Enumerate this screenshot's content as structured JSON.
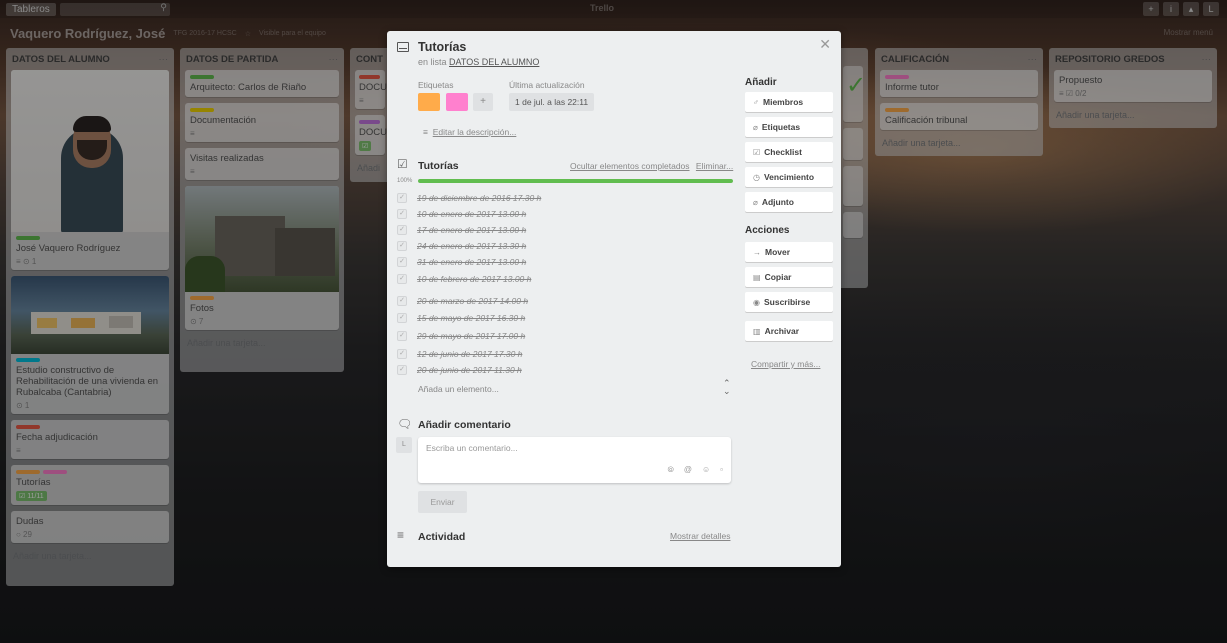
{
  "topbar": {
    "boards_label": "Tableros",
    "logo": "Trello",
    "right_icons": [
      "+",
      "i",
      "▴",
      "L"
    ]
  },
  "board": {
    "title": "Vaquero Rodríguez, José",
    "tag": "TFG 2016-17 HCSC",
    "visibility": "Visible para el equipo",
    "menu": "Mostrar menú"
  },
  "lists": [
    {
      "title": "DATOS DEL ALUMNO",
      "cards": [
        {
          "title": "José Vaquero Rodríguez",
          "badges": "≡  ⊙ 1"
        },
        {
          "title": "Estudio constructivo de Rehabilitación de una vivienda en Rubalcaba (Cantabria)",
          "badges": "⊙ 1"
        },
        {
          "title": "Fecha adjudicación",
          "badges": "≡"
        },
        {
          "title": "Tutorías",
          "badges": "☑ 11/11"
        },
        {
          "title": "Dudas",
          "badges": "○ 29"
        }
      ],
      "add": "Añadir una tarjeta..."
    },
    {
      "title": "DATOS DE PARTIDA",
      "cards": [
        {
          "title": "Arquitecto: Carlos de Riaño",
          "badges": ""
        },
        {
          "title": "Documentación",
          "badges": "≡"
        },
        {
          "title": "Visitas realizadas",
          "badges": "≡"
        },
        {
          "title": "Fotos",
          "badges": "⊙ 7"
        }
      ],
      "add": "Añadir una tarjeta..."
    },
    {
      "title": "CONT",
      "cards": [
        {
          "title": "DOCU",
          "badges": "≡"
        },
        {
          "title": "DOCU",
          "badges": ""
        }
      ],
      "add": "Añadi"
    },
    {
      "title": "CALIFICACIÓN",
      "cards": [
        {
          "title": "Informe tutor",
          "badges": ""
        },
        {
          "title": "Calificación tribunal",
          "badges": ""
        }
      ],
      "add": "Añadir una tarjeta..."
    },
    {
      "title": "REPOSITORIO GREDOS",
      "cards": [
        {
          "title": "Propuesto",
          "badges": "≡  ☑ 0/2"
        }
      ],
      "add": "Añadir una tarjeta..."
    }
  ],
  "modal": {
    "title": "Tutorías",
    "in_list_prefix": "en lista",
    "in_list_name": "DATOS DEL ALUMNO",
    "labels_heading": "Etiquetas",
    "updated_heading": "Última actualización",
    "updated_value": "1 de jul. a las 22:11",
    "label_colors": [
      "#ffab4a",
      "#ff80ce"
    ],
    "edit_description": "Editar la descripción...",
    "checklist": {
      "title": "Tutorías",
      "hide_completed": "Ocultar elementos completados",
      "delete": "Eliminar...",
      "percent": "100%",
      "progress": 1.0,
      "items": [
        "19 de diciembre de 2016 17.30 h",
        "10 de enero de 2017 13.00 h",
        "17 de enero de 2017 13.00 h",
        "24 de enero de 2017 13.30 h",
        "31 de enero de 2017 13.00 h",
        "10 de febrero de 2017 13.00 h",
        "20 de marzo de 2017 14.00 h",
        "15 de mayo de 2017 16.30 h",
        "29 de mayo de 2017 17.00 h",
        "12 de junio de 2017 17.30 h",
        "20 de junio de 2017 11.30 h"
      ],
      "add_item": "Añada un elemento..."
    },
    "comment": {
      "heading": "Añadir comentario",
      "avatar": "L",
      "placeholder": "Escriba un comentario...",
      "send": "Enviar"
    },
    "activity": {
      "heading": "Actividad",
      "show_details": "Mostrar detalles"
    },
    "sidebar": {
      "add_heading": "Añadir",
      "add_buttons": [
        {
          "label": "Miembros",
          "icon": "♂"
        },
        {
          "label": "Etiquetas",
          "icon": "⌀"
        },
        {
          "label": "Checklist",
          "icon": "☑"
        },
        {
          "label": "Vencimiento",
          "icon": "◷"
        },
        {
          "label": "Adjunto",
          "icon": "⌀"
        }
      ],
      "actions_heading": "Acciones",
      "action_buttons": [
        {
          "label": "Mover",
          "icon": "→"
        },
        {
          "label": "Copiar",
          "icon": "▤"
        },
        {
          "label": "Suscribirse",
          "icon": "◉"
        },
        {
          "label": "Archivar",
          "icon": "▥"
        }
      ],
      "share": "Compartir y más..."
    }
  },
  "colors": {
    "green": "#61bd4f",
    "yellow": "#f2d600",
    "orange": "#ffab4a",
    "red": "#eb5a46",
    "purple": "#c377e0",
    "sky": "#00c2e0",
    "pink": "#ff80ce"
  }
}
